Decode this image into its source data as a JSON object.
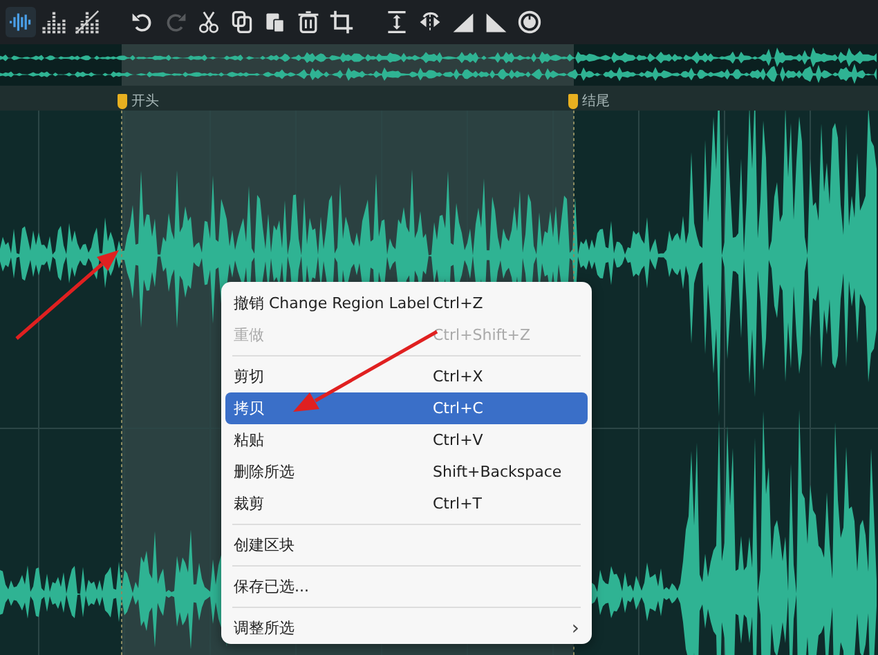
{
  "toolbar": {
    "buttons": [
      {
        "kind": "waveform",
        "disabled": false,
        "selected": true
      },
      {
        "kind": "spectrum",
        "disabled": false,
        "selected": false
      },
      {
        "kind": "spectrum-off",
        "disabled": false,
        "selected": false
      },
      {
        "kind": "undo",
        "disabled": false,
        "selected": false
      },
      {
        "kind": "redo",
        "disabled": true,
        "selected": false
      },
      {
        "kind": "cut",
        "disabled": false,
        "selected": false
      },
      {
        "kind": "copy",
        "disabled": false,
        "selected": false
      },
      {
        "kind": "paste",
        "disabled": false,
        "selected": false
      },
      {
        "kind": "delete",
        "disabled": false,
        "selected": false
      },
      {
        "kind": "crop",
        "disabled": false,
        "selected": false
      },
      {
        "kind": "normalize",
        "disabled": false,
        "selected": false
      },
      {
        "kind": "reverse",
        "disabled": false,
        "selected": false
      },
      {
        "kind": "fade-in",
        "disabled": false,
        "selected": false
      },
      {
        "kind": "fade-out",
        "disabled": false,
        "selected": false
      },
      {
        "kind": "knob",
        "disabled": false,
        "selected": false
      }
    ]
  },
  "markers": [
    {
      "label": "开头"
    },
    {
      "label": "结尾"
    }
  ],
  "context_menu": {
    "items": [
      {
        "kind": "item",
        "label": "撤销 Change Region Label",
        "shortcut": "Ctrl+Z",
        "disabled": false,
        "selected": false
      },
      {
        "kind": "item",
        "label": "重做",
        "shortcut": "Ctrl+Shift+Z",
        "disabled": true,
        "selected": false
      },
      {
        "kind": "separator"
      },
      {
        "kind": "item",
        "label": "剪切",
        "shortcut": "Ctrl+X",
        "disabled": false,
        "selected": false
      },
      {
        "kind": "item",
        "label": "拷贝",
        "shortcut": "Ctrl+C",
        "disabled": false,
        "selected": true
      },
      {
        "kind": "item",
        "label": "粘贴",
        "shortcut": "Ctrl+V",
        "disabled": false,
        "selected": false
      },
      {
        "kind": "item",
        "label": "删除所选",
        "shortcut": "Shift+Backspace",
        "disabled": false,
        "selected": false
      },
      {
        "kind": "item",
        "label": "裁剪",
        "shortcut": "Ctrl+T",
        "disabled": false,
        "selected": false
      },
      {
        "kind": "separator"
      },
      {
        "kind": "item",
        "label": "创建区块",
        "disabled": false,
        "selected": false
      },
      {
        "kind": "separator"
      },
      {
        "kind": "item",
        "label": "保存已选...",
        "disabled": false,
        "selected": false
      },
      {
        "kind": "separator"
      },
      {
        "kind": "submenu",
        "label": "调整所选",
        "arrow": "›",
        "disabled": false,
        "selected": false
      }
    ]
  }
}
